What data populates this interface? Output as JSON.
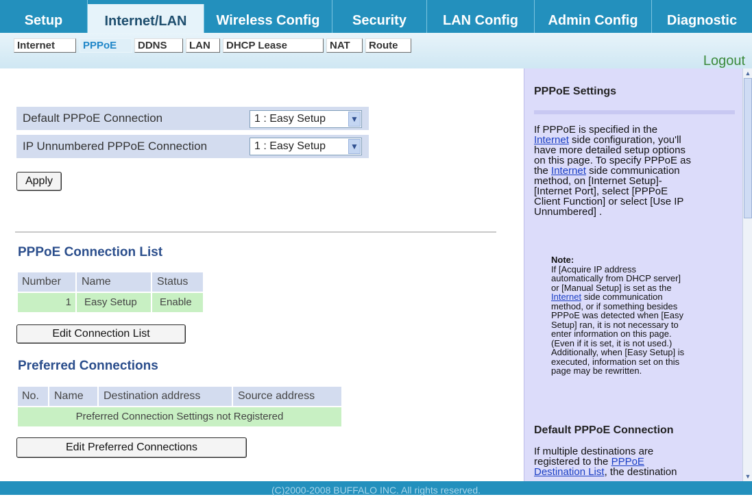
{
  "topnav": {
    "tabs": [
      {
        "label": "Setup"
      },
      {
        "label": "Internet/LAN"
      },
      {
        "label": "Wireless Config"
      },
      {
        "label": "Security"
      },
      {
        "label": "LAN Config"
      },
      {
        "label": "Admin Config"
      },
      {
        "label": "Diagnostic"
      }
    ],
    "active_index": 1
  },
  "subnav": {
    "tabs": [
      {
        "label": "Internet"
      },
      {
        "label": "PPPoE"
      },
      {
        "label": "DDNS"
      },
      {
        "label": "LAN"
      },
      {
        "label": "DHCP Lease"
      },
      {
        "label": "NAT"
      },
      {
        "label": "Route"
      }
    ],
    "active_index": 1,
    "logout": "Logout"
  },
  "settings": {
    "default_label": "Default PPPoE Connection",
    "default_value": "1 : Easy Setup",
    "unnumbered_label": "IP Unnumbered PPPoE Connection",
    "unnumbered_value": "1 : Easy Setup",
    "apply": "Apply"
  },
  "connection_list": {
    "title": "PPPoE Connection List",
    "headers": [
      "Number",
      "Name",
      "Status"
    ],
    "rows": [
      [
        "1",
        "Easy Setup",
        "Enable"
      ]
    ],
    "edit_button": "Edit Connection List"
  },
  "preferred": {
    "title": "Preferred Connections",
    "headers": [
      "No.",
      "Name",
      "Destination address",
      "Source address"
    ],
    "empty_text": "Preferred Connection Settings not Registered",
    "edit_button": "Edit Preferred Connections"
  },
  "help": {
    "title": "PPPoE Settings",
    "para1_a": "If PPPoE is specified in the",
    "link_internet": "Internet",
    "para1_b": "side configuration, you'll",
    "para1_c": "have more detailed setup options",
    "para1_d": "on this page. To specify PPPoE as",
    "para1_e": "the",
    "para1_f": "side communication",
    "para1_g": "method, on [Internet Setup]-",
    "para1_h": "[Internet Port], select [PPPoE",
    "para1_i": "Client Function] or select [Use IP",
    "para1_j": "Unnumbered] .",
    "note_title": "Note:",
    "note_1": "If [Acquire IP address",
    "note_2": "automatically from DHCP server]",
    "note_3": "or [Manual Setup] is set as the",
    "note_4b": "side communication",
    "note_5": "method, or if something besides",
    "note_6": "PPPoE was detected when [Easy",
    "note_7": "Setup] ran, it is not necessary to",
    "note_8": "enter information on this page.",
    "note_9": "(Even if it is set, it is not used.)",
    "note_10": "Additionally, when [Easy Setup] is",
    "note_11": "executed, information set on this",
    "note_12": "page may be rewritten.",
    "section2_title": "Default PPPoE Connection",
    "s2_1": "If multiple destinations are",
    "s2_2a": "registered to the",
    "s2_link1": "PPPoE",
    "s2_link2": "Destination List",
    "s2_3b": ", the destination"
  },
  "footer": "(C)2000-2008 BUFFALO INC. All rights reserved."
}
